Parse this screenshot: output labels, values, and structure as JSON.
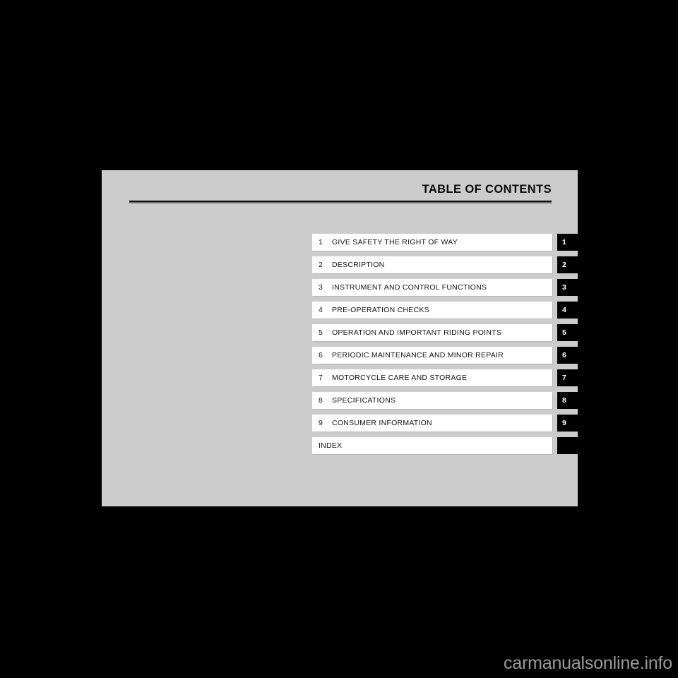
{
  "page": {
    "background_color": "#000000",
    "sheet_color": "#cccccc",
    "row_color": "#ffffff",
    "tab_color": "#000000"
  },
  "header": {
    "title": "TABLE OF CONTENTS"
  },
  "contents": {
    "entries": [
      {
        "number": "1",
        "label": "GIVE SAFETY THE RIGHT OF WAY",
        "tab": "1"
      },
      {
        "number": "2",
        "label": "DESCRIPTION",
        "tab": "2"
      },
      {
        "number": "3",
        "label": "INSTRUMENT AND CONTROL FUNCTIONS",
        "tab": "3"
      },
      {
        "number": "4",
        "label": "PRE-OPERATION CHECKS",
        "tab": "4"
      },
      {
        "number": "5",
        "label": "OPERATION AND IMPORTANT RIDING POINTS",
        "tab": "5"
      },
      {
        "number": "6",
        "label": "PERIODIC MAINTENANCE AND MINOR REPAIR",
        "tab": "6"
      },
      {
        "number": "7",
        "label": "MOTORCYCLE CARE AND STORAGE",
        "tab": "7"
      },
      {
        "number": "8",
        "label": "SPECIFICATIONS",
        "tab": "8"
      },
      {
        "number": "9",
        "label": "CONSUMER INFORMATION",
        "tab": "9"
      },
      {
        "number": "",
        "label": "INDEX",
        "tab": ""
      }
    ]
  },
  "watermark": {
    "text": "carmanualsonline.info"
  }
}
